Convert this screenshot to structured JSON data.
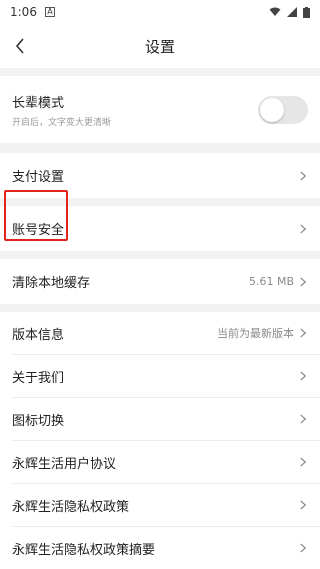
{
  "status_bar": {
    "time": "1:06",
    "badge": "A"
  },
  "header": {
    "title": "设置"
  },
  "items": {
    "elder_mode": {
      "label": "长辈模式",
      "subtitle": "开启后，文字变大更清晰",
      "enabled": false
    },
    "payment": {
      "label": "支付设置"
    },
    "account_security": {
      "label": "账号安全"
    },
    "clear_cache": {
      "label": "清除本地缓存",
      "value": "5.61 MB"
    },
    "version": {
      "label": "版本信息",
      "value": "当前为最新版本"
    },
    "about": {
      "label": "关于我们"
    },
    "icon_switch": {
      "label": "图标切换"
    },
    "user_agreement": {
      "label": "永辉生活用户协议"
    },
    "privacy_policy": {
      "label": "永辉生活隐私权政策"
    },
    "privacy_summary": {
      "label": "永辉生活隐私权政策摘要"
    }
  },
  "colors": {
    "highlight": "#e0241d",
    "background": "#f2f2f2"
  }
}
